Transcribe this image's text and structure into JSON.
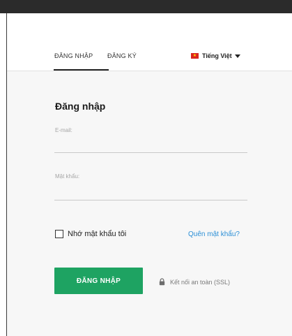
{
  "tabs": {
    "login": "ĐĂNG NHẬP",
    "register": "ĐĂNG KÝ"
  },
  "language": {
    "label": "Tiếng Việt",
    "flag_icon": "vietnam-flag-icon",
    "flag_color": "#da251d"
  },
  "form": {
    "title": "Đăng nhập",
    "email_label": "E-mail:",
    "email_value": "",
    "password_label": "Mật khẩu:",
    "password_value": "",
    "remember_label": "Nhớ mật khẩu tôi",
    "remember_checked": false,
    "forgot_link": "Quên mật khẩu?",
    "submit_label": "ĐĂNG NHẬP",
    "ssl_note": "Kết nối an toàn (SSL)",
    "ssl_icon": "lock-icon"
  },
  "colors": {
    "accent": "#1ea362",
    "link": "#2b8fd6",
    "panel_bg": "#f7f7f7"
  }
}
